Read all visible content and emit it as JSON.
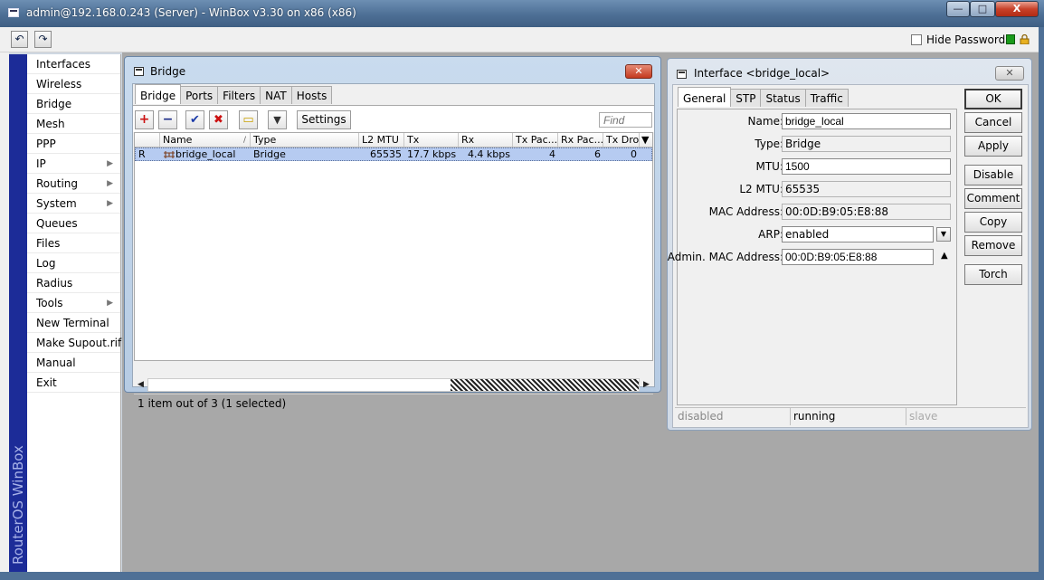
{
  "window": {
    "title": "admin@192.168.0.243 (Server) - WinBox v3.30 on x86 (x86)",
    "buttons": {
      "minimize": "—",
      "maximize": "□",
      "close": "X"
    }
  },
  "toolbar": {
    "undo": "↶",
    "redo": "↷",
    "hide_passwords": "Hide Passwords"
  },
  "sidebar": {
    "brand": "RouterOS WinBox",
    "items": [
      {
        "label": "Interfaces",
        "submenu": false
      },
      {
        "label": "Wireless",
        "submenu": false
      },
      {
        "label": "Bridge",
        "submenu": false
      },
      {
        "label": "Mesh",
        "submenu": false
      },
      {
        "label": "PPP",
        "submenu": false
      },
      {
        "label": "IP",
        "submenu": true
      },
      {
        "label": "Routing",
        "submenu": true
      },
      {
        "label": "System",
        "submenu": true
      },
      {
        "label": "Queues",
        "submenu": false
      },
      {
        "label": "Files",
        "submenu": false
      },
      {
        "label": "Log",
        "submenu": false
      },
      {
        "label": "Radius",
        "submenu": false
      },
      {
        "label": "Tools",
        "submenu": true
      },
      {
        "label": "New Terminal",
        "submenu": false
      },
      {
        "label": "Make Supout.rif",
        "submenu": false
      },
      {
        "label": "Manual",
        "submenu": false
      },
      {
        "label": "Exit",
        "submenu": false
      }
    ]
  },
  "bridge_window": {
    "title": "Bridge",
    "close": "✕",
    "tabs": [
      "Bridge",
      "Ports",
      "Filters",
      "NAT",
      "Hosts"
    ],
    "actions": {
      "add": "+",
      "remove": "−",
      "enable": "✔",
      "disable": "✖",
      "comment": "▭",
      "filter": "▼"
    },
    "settings_label": "Settings",
    "find_placeholder": "Find",
    "columns": [
      "",
      "Name",
      "Type",
      "L2 MTU",
      "Tx",
      "Rx",
      "Tx Pac...",
      "Rx Pac...",
      "Tx Drop"
    ],
    "sort_indicator": "/",
    "column_menu": "▼",
    "rows": [
      {
        "flag": "R",
        "name": "bridge_local",
        "type": "Bridge",
        "l2mtu": "65535",
        "tx": "17.7 kbps",
        "rx": "4.4 kbps",
        "txpac": "4",
        "rxpac": "6",
        "txdrop": "0"
      }
    ],
    "status": "1 item out of 3 (1 selected)"
  },
  "interface_window": {
    "title": "Interface <bridge_local>",
    "close": "✕",
    "tabs": [
      "General",
      "STP",
      "Status",
      "Traffic"
    ],
    "fields": {
      "name": {
        "label": "Name:",
        "value": "bridge_local"
      },
      "type": {
        "label": "Type:",
        "value": "Bridge"
      },
      "mtu": {
        "label": "MTU:",
        "value": "1500"
      },
      "l2mtu": {
        "label": "L2 MTU:",
        "value": "65535"
      },
      "mac": {
        "label": "MAC Address:",
        "value": "00:0D:B9:05:E8:88"
      },
      "arp": {
        "label": "ARP:",
        "value": "enabled"
      },
      "admin_mac": {
        "label": "Admin. MAC Address:",
        "value": "00:0D:B9:05:E8:88"
      }
    },
    "buttons": [
      "OK",
      "Cancel",
      "Apply",
      "Disable",
      "Comment",
      "Copy",
      "Remove",
      "Torch"
    ],
    "status": [
      "disabled",
      "running",
      "slave"
    ]
  },
  "colors": {
    "sidebar_strip": "#1c2c98",
    "selection": "#b6cbf1",
    "accent_add": "#cc1111",
    "accent_remove": "#1a2a88",
    "accent_enable": "#1a3aa8",
    "accent_disable": "#cc1111"
  }
}
